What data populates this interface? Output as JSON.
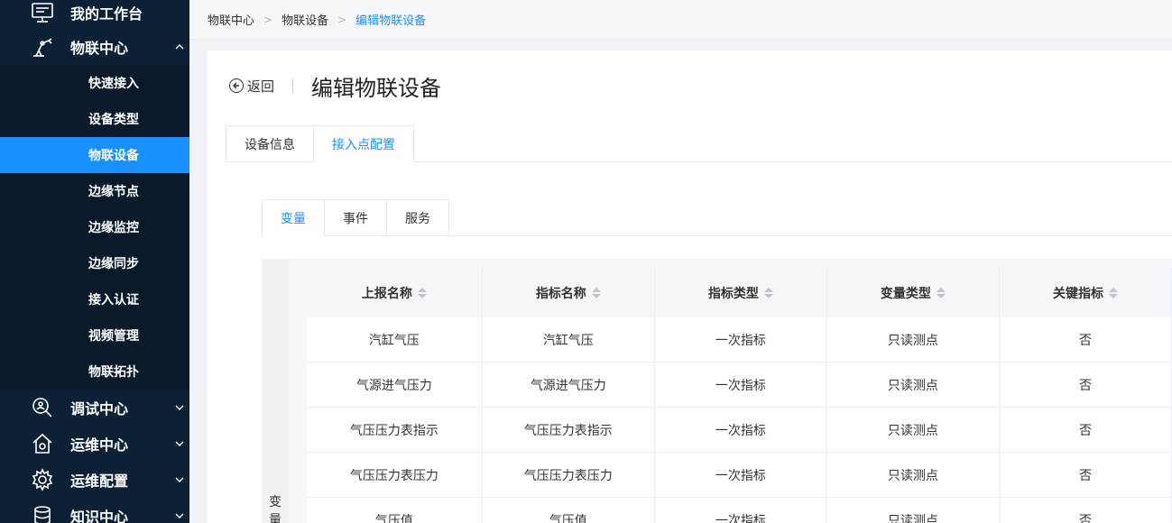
{
  "sidebar": {
    "top_item": {
      "label": "我的工作台",
      "icon": "monitor-icon"
    },
    "groups": [
      {
        "label": "物联中心",
        "icon": "robot-arm-icon",
        "expanded": true
      },
      {
        "label": "调试中心",
        "icon": "search-debug-icon",
        "expanded": false
      },
      {
        "label": "运维中心",
        "icon": "home-gear-icon",
        "expanded": false
      },
      {
        "label": "运维配置",
        "icon": "gear-icon",
        "expanded": false
      },
      {
        "label": "知识中心",
        "icon": "database-icon",
        "expanded": false
      }
    ],
    "sub_items": [
      {
        "label": "快速接入"
      },
      {
        "label": "设备类型"
      },
      {
        "label": "物联设备",
        "active": true
      },
      {
        "label": "边缘节点"
      },
      {
        "label": "边缘监控"
      },
      {
        "label": "边缘同步"
      },
      {
        "label": "接入认证"
      },
      {
        "label": "视频管理"
      },
      {
        "label": "物联拓扑"
      }
    ]
  },
  "breadcrumb": [
    "物联中心",
    "物联设备",
    "编辑物联设备"
  ],
  "header": {
    "back_label": "返回",
    "title": "编辑物联设备"
  },
  "tabs": [
    {
      "label": "设备信息",
      "active": false
    },
    {
      "label": "接入点配置",
      "active": true
    }
  ],
  "sub_tabs": [
    {
      "label": "变量",
      "active": true
    },
    {
      "label": "事件",
      "active": false
    },
    {
      "label": "服务",
      "active": false
    }
  ],
  "variable_panel": {
    "side_label": "变量"
  },
  "table": {
    "columns": [
      "上报名称",
      "指标名称",
      "指标类型",
      "变量类型",
      "关键指标"
    ],
    "rows": [
      [
        "汽缸气压",
        "汽缸气压",
        "一次指标",
        "只读测点",
        "否"
      ],
      [
        "气源进气压力",
        "气源进气压力",
        "一次指标",
        "只读测点",
        "否"
      ],
      [
        "气压压力表指示",
        "气压压力表指示",
        "一次指标",
        "只读测点",
        "否"
      ],
      [
        "气压压力表压力",
        "气压压力表压力",
        "一次指标",
        "只读测点",
        "否"
      ],
      [
        "气压值",
        "气压值",
        "一次指标",
        "只读测点",
        "否"
      ]
    ]
  },
  "colors": {
    "accent": "#1890ff",
    "sidebar_bg": "#0c2135"
  }
}
